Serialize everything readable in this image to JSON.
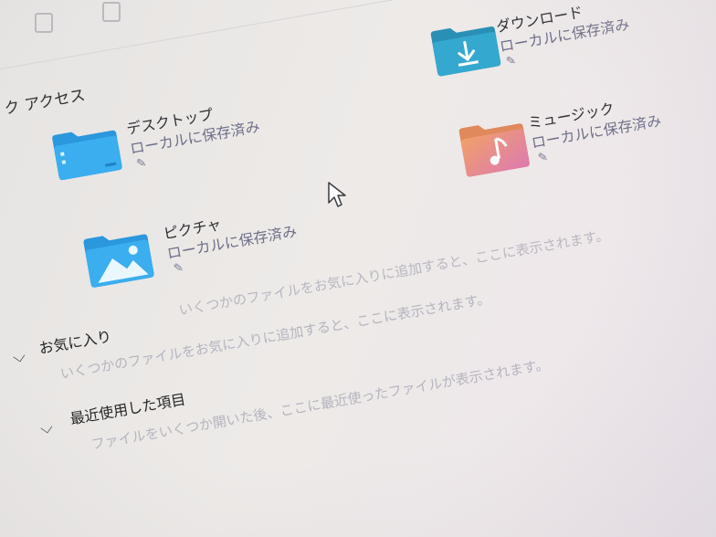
{
  "quick_access": {
    "title": "ク アクセス",
    "items": [
      {
        "name": "デスクトップ",
        "sub": "ローカルに保存済み",
        "icon": "desktop-folder-icon"
      },
      {
        "name": "ピクチャ",
        "sub": "ローカルに保存済み",
        "icon": "pictures-folder-icon"
      },
      {
        "name": "ダウンロード",
        "sub": "ローカルに保存済み",
        "icon": "downloads-folder-icon"
      },
      {
        "name": "ミュージック",
        "sub": "ローカルに保存済み",
        "icon": "music-folder-icon"
      }
    ],
    "hint": "いくつかのファイルをお気に入りに追加すると、ここに表示されます。"
  },
  "favorites": {
    "title": "お気に入り",
    "empty_text": "いくつかのファイルをお気に入りに追加すると、ここに表示されます。"
  },
  "recent": {
    "title": "最近使用した項目",
    "empty_text": "ファイルをいくつか開いた後、ここに最近使ったファイルが表示されます。"
  },
  "colors": {
    "folder_blue": "#2fa3e6",
    "folder_blue_light": "#6fc6f5",
    "download_teal": "#2f9fbf",
    "music_orange": "#ef9a6b",
    "music_pink": "#e17fa6"
  }
}
